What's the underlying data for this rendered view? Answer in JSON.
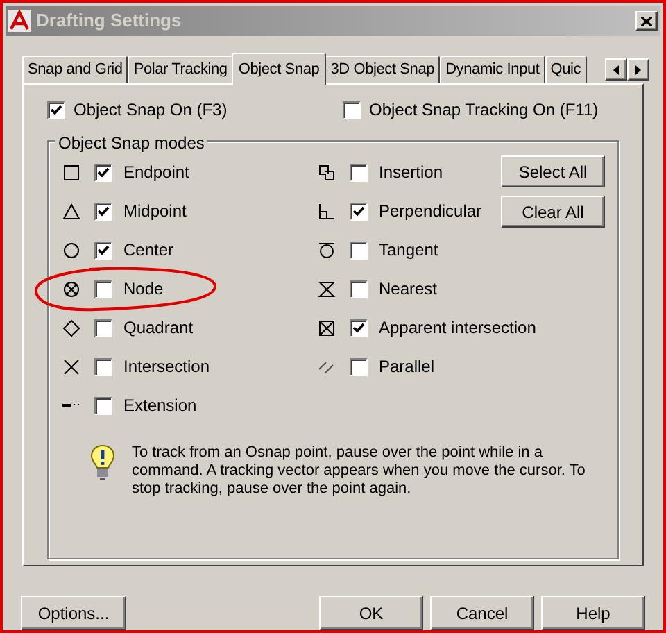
{
  "window": {
    "title": "Drafting Settings"
  },
  "tabs": [
    {
      "label": "Snap and Grid",
      "selected": false
    },
    {
      "label": "Polar Tracking",
      "selected": false
    },
    {
      "label": "Object Snap",
      "selected": true
    },
    {
      "label": "3D Object Snap",
      "selected": false
    },
    {
      "label": "Dynamic Input",
      "selected": false
    },
    {
      "label": "Quic",
      "selected": false
    }
  ],
  "object_snap_on": {
    "label": "Object Snap On (F3)",
    "checked": true
  },
  "object_snap_tracking_on": {
    "label": "Object Snap Tracking On (F11)",
    "checked": false
  },
  "modes_group": {
    "title": "Object Snap modes",
    "left": [
      {
        "kind": "square",
        "label": "Endpoint",
        "checked": true
      },
      {
        "kind": "triangle",
        "label": "Midpoint",
        "checked": true
      },
      {
        "kind": "circle",
        "label": "Center",
        "checked": true
      },
      {
        "kind": "node",
        "label": "Node",
        "checked": false
      },
      {
        "kind": "diamond",
        "label": "Quadrant",
        "checked": false
      },
      {
        "kind": "cross",
        "label": "Intersection",
        "checked": false
      },
      {
        "kind": "extension",
        "label": "Extension",
        "checked": false
      }
    ],
    "right": [
      {
        "kind": "insertion",
        "label": "Insertion",
        "checked": false
      },
      {
        "kind": "perpendicular",
        "label": "Perpendicular",
        "checked": true
      },
      {
        "kind": "tangent",
        "label": "Tangent",
        "checked": false
      },
      {
        "kind": "nearest",
        "label": "Nearest",
        "checked": false
      },
      {
        "kind": "apparent",
        "label": "Apparent intersection",
        "checked": true
      },
      {
        "kind": "parallel",
        "label": "Parallel",
        "checked": false
      }
    ],
    "buttons": [
      "Select All",
      "Clear All"
    ]
  },
  "tip": "To track from an Osnap point, pause over the point while in a command.  A tracking vector appears when you move the cursor. To stop tracking, pause over the point again.",
  "footer": {
    "left_button": "Options...",
    "buttons": [
      "OK",
      "Cancel",
      "Help"
    ]
  }
}
